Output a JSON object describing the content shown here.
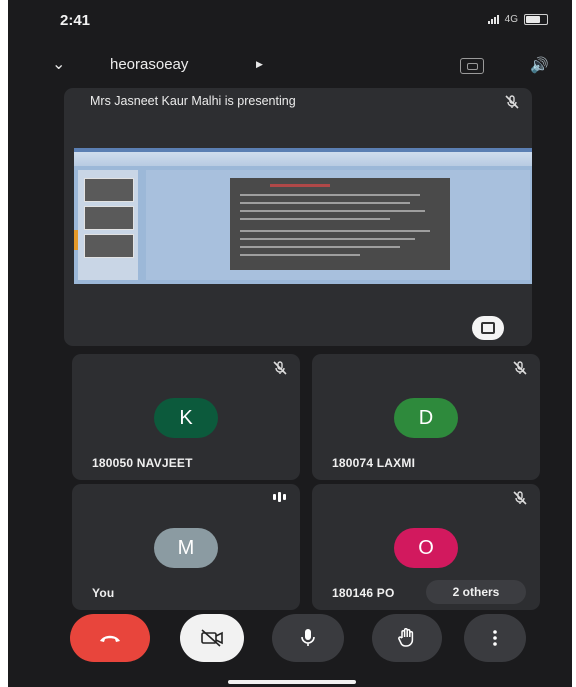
{
  "status_bar": {
    "time": "2:41",
    "network": "4G"
  },
  "header": {
    "meeting_code": "heorasoeay"
  },
  "presentation": {
    "label": "Mrs Jasneet Kaur Malhi is presenting"
  },
  "participants": [
    {
      "name": "180050 NAVJEET",
      "initial": "K",
      "avatar_color": "#0c5a3c",
      "muted": true
    },
    {
      "name": "180074 LAXMI",
      "initial": "D",
      "avatar_color": "#2e8a3c",
      "muted": true
    },
    {
      "name": "You",
      "initial": "M",
      "avatar_color": "#8b9ba2",
      "muted": false
    },
    {
      "name": "180146 PO",
      "initial": "O",
      "avatar_color": "#d2195e",
      "muted": true
    }
  ],
  "others_chip": "2 others",
  "colors": {
    "end_call": "#e8453c",
    "background": "#1b1b1d",
    "tile": "#2d2e31"
  }
}
